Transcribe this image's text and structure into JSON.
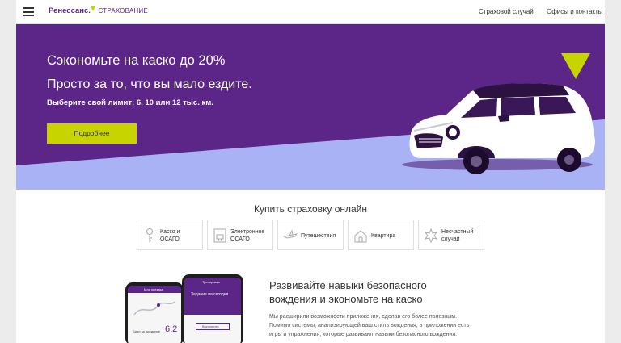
{
  "header": {
    "logo_name": "Ренессанс.",
    "logo_sub": "СТРАХОВАНИЕ",
    "links": [
      "Страховой случай",
      "Офисы и контакты"
    ]
  },
  "hero": {
    "title": "Сэкономьте на каско до 20%",
    "subtitle": "Просто за то, что вы мало ездите.",
    "limit_text": "Выберите свой лимит: 6, 10 или 12 тыс. км.",
    "button_label": "Подробнее"
  },
  "buy_online": {
    "title": "Купить страховку онлайн",
    "cards": [
      {
        "label": "Каско и\nОСАГО",
        "icon": "key-icon"
      },
      {
        "label": "Электронное\nОСАГО",
        "icon": "document-car-icon"
      },
      {
        "label": "Путешествия",
        "icon": "plane-icon"
      },
      {
        "label": "Квартира",
        "icon": "house-icon"
      },
      {
        "label": "Несчастный\nслучай",
        "icon": "accident-icon"
      }
    ]
  },
  "app_section": {
    "title": "Развивайте навыки безопасного\nвождения и экономьте на каско",
    "text": "Мы расширили возможности приложения, сделав его более полезным.\nПомимо системы, анализирующей ваш стиль вождения, в приложении есть\nигры и упражнения, которые развивают навыки безопасного вождения.",
    "phone1": {
      "header": "Моя поездка",
      "label": "Балл за вождение",
      "score": "6,2"
    },
    "phone2": {
      "header": "Тренировка",
      "task_title": "Задание на сегодня",
      "button": "Выполнить"
    }
  },
  "colors": {
    "brand_purple": "#5c2588",
    "accent_lime": "#c8d400",
    "lavender": "#a9b2f4"
  }
}
